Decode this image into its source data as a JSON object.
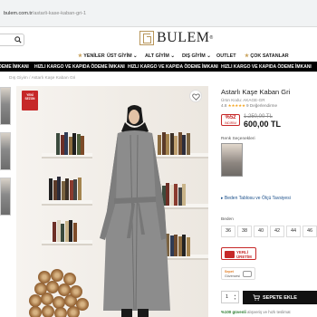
{
  "browser": {
    "url_host": "bulem.com.tr",
    "url_path": "/astarli-kase-kaban-gri-1"
  },
  "header": {
    "brand": "BULEM",
    "nav": [
      {
        "label": "YENİLER",
        "star": true
      },
      {
        "label": "ÜST GİYİM",
        "caret": true
      },
      {
        "label": "ALT GİYİM",
        "caret": true
      },
      {
        "label": "DIŞ GİYİM",
        "caret": true
      },
      {
        "label": "OUTLET",
        "caret": false
      },
      {
        "label": "ÇOK SATANLAR",
        "star": true
      }
    ]
  },
  "ticker": {
    "text": "HIZLI KARGO VE KAPIDA ÖDEME İMKANI"
  },
  "breadcrumb": {
    "items": [
      "Dış Giyim",
      "Astarlı Kaşe Kaban Gri"
    ],
    "sep": "/"
  },
  "product": {
    "badge": "YENİ SEZON",
    "title": "Astarlı Kaşe Kaban Gri",
    "code_label": "Ürün Kodu:",
    "code": "AKAGE-GR",
    "rating": "4.8",
    "stars": "★★★★★",
    "reviews": "9 Değerlendirme",
    "discount_pct": "%52",
    "discount_label": "İNDİRİM",
    "old_price": "1.250,00 TL",
    "price": "600,00 TL",
    "color_label": "Renk Seçenekleri",
    "size_guide": "Beden Tablosu ve Ölçü Tavsiyesi",
    "size_label": "Beden",
    "sizes": [
      "36",
      "38",
      "40",
      "42",
      "44",
      "46"
    ],
    "stock_badge_line1": "YERLİ",
    "stock_badge_line2": "ÜRETİM",
    "pay_line1": "Sepet",
    "pay_line2": "Güvencesi",
    "qty": "1",
    "cart_button": "SEPETE EKLE",
    "footnote_prefix": "%100 güvenli",
    "footnote": " alışveriş ve hızlı teslimat"
  },
  "colors": {
    "accent": "#c62828",
    "brand": "#b8965a",
    "ticker": "#000000"
  }
}
